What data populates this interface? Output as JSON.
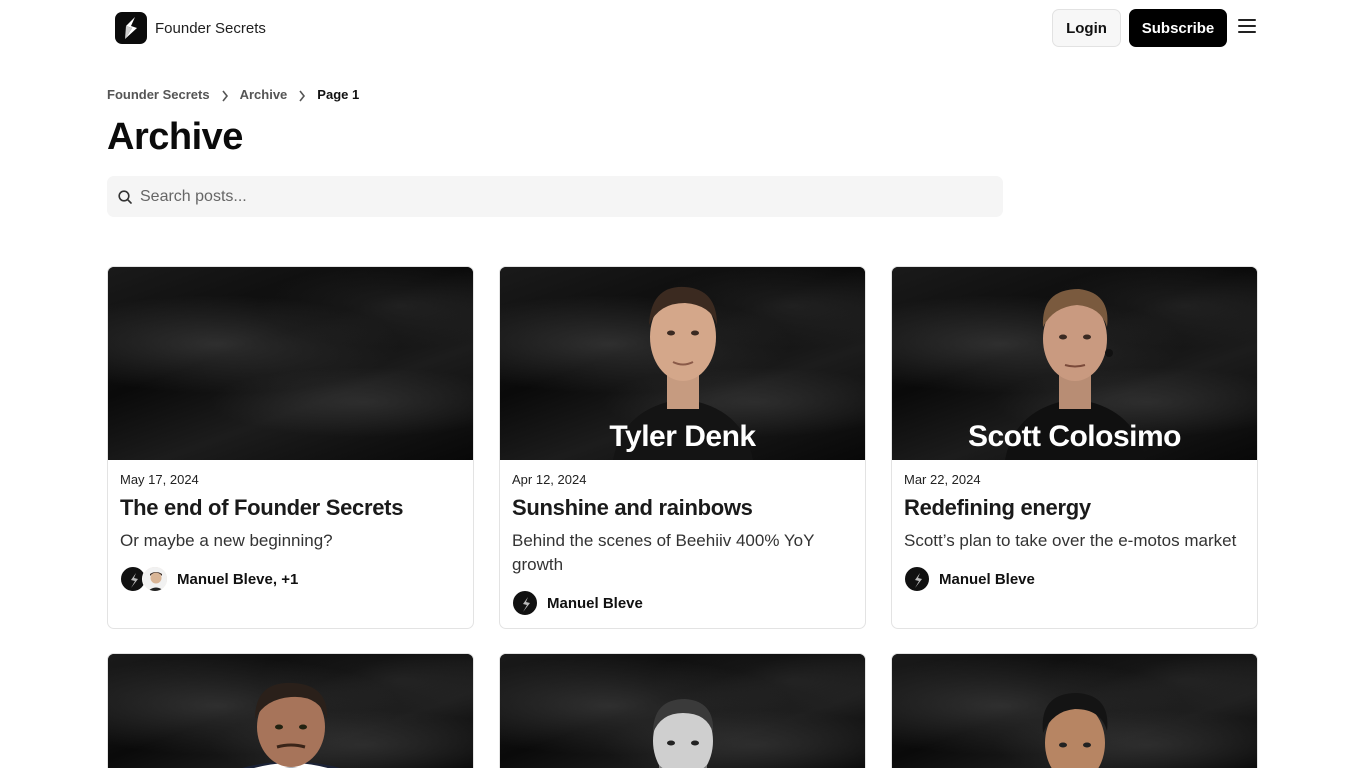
{
  "header": {
    "brand_name": "Founder Secrets",
    "login_label": "Login",
    "subscribe_label": "Subscribe"
  },
  "breadcrumb": {
    "items": [
      "Founder Secrets",
      "Archive",
      "Page 1"
    ]
  },
  "page": {
    "title": "Archive"
  },
  "search": {
    "placeholder": "Search posts..."
  },
  "posts": [
    {
      "image_caption": "",
      "date": "May 17, 2024",
      "title": "The end of Founder Secrets",
      "subtitle": "Or maybe a new beginning?",
      "authors": "Manuel Bleve, +1"
    },
    {
      "image_caption": "Tyler Denk",
      "date": "Apr 12, 2024",
      "title": "Sunshine and rainbows",
      "subtitle": "Behind the scenes of Beehiiv 400% YoY growth",
      "authors": "Manuel Bleve"
    },
    {
      "image_caption": "Scott Colosimo",
      "date": "Mar 22, 2024",
      "title": "Redefining energy",
      "subtitle": "Scott’s plan to take over the e-motos market",
      "authors": "Manuel Bleve"
    }
  ],
  "colors": {
    "accent": "#000000",
    "card_border": "#e3e3e3",
    "search_bg": "#f5f5f5"
  }
}
